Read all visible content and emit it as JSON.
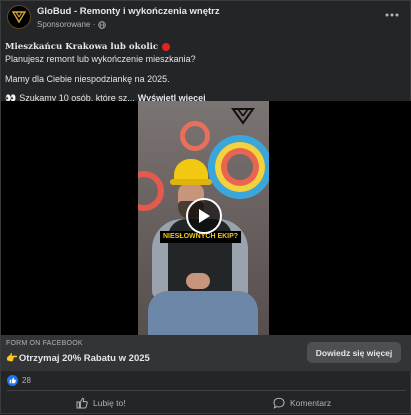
{
  "post": {
    "page_name": "GloBud - Remonty i wykończenia wnętrz",
    "sponsored_label": "Sponsorowane ·",
    "avatar_text": "GLOBUD",
    "more_icon": "more-horizontal-icon"
  },
  "body": {
    "line1": "Mieszkańcu Krakowa lub okolic",
    "line2": "Planujesz remont lub wykończenie mieszkania?",
    "line3": "Mamy dla Ciebie niespodziankę na 2025.",
    "line4_emoji": "👀",
    "line4": "Szukamy 10 osób, które sz...",
    "see_more": "Wyświetl więcej"
  },
  "video": {
    "caption": "NIESŁOWNYCH EKIP?",
    "play_icon": "play-icon",
    "logo_text": "GloBud"
  },
  "form": {
    "label": "FORM ON FACEBOOK",
    "headline_emoji": "👉",
    "headline": "Otrzymaj 20% Rabatu w 2025",
    "cta": "Dowiedz się więcej"
  },
  "reactions": {
    "count": "28"
  },
  "actions": {
    "like": "Lubię to!",
    "comment": "Komentarz"
  },
  "colors": {
    "background": "#242526",
    "accent": "#1877f2",
    "helmet": "#f2c811"
  }
}
